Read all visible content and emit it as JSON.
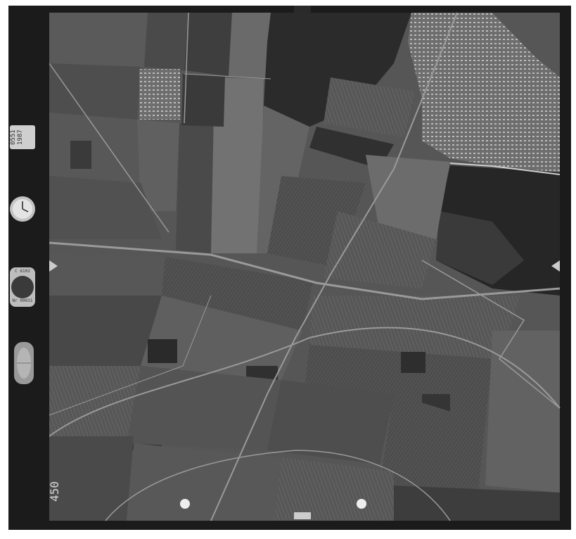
{
  "photo": {
    "frame_number": "450",
    "date_stamp": "1987",
    "frame_code": "0551",
    "counter_label_top": "C 6102",
    "counter_label_bottom": "Nr 09031"
  },
  "instruments": {
    "clock": "clock-icon",
    "altimeter": "altimeter-icon",
    "level": "bubble-level-icon"
  },
  "colors": {
    "frame_border": "#1b1b1b",
    "field_dark": "#2c2c2c",
    "field_mid": "#5c5c5c",
    "field_light": "#8a8a8a",
    "water": "#262626",
    "settlement": "#c9c9c9"
  }
}
